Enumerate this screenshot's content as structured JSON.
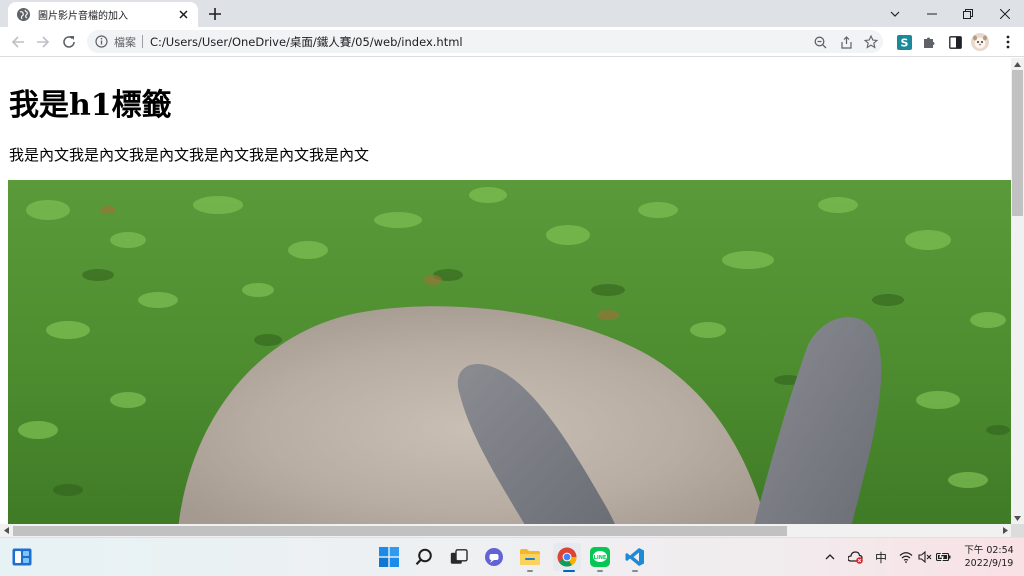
{
  "tab": {
    "title": "圖片影片音檔的加入"
  },
  "address_bar": {
    "security_label": "檔案",
    "url": "C:/Users/User/OneDrive/桌面/鐵人賽/05/web/index.html"
  },
  "page": {
    "heading": "我是h1標籤",
    "paragraph": "我是內文我是內文我是內文我是內文我是內文我是內文",
    "image_subject": "gray rabbit on grass"
  },
  "taskbar": {
    "ime": "中",
    "clock_time": "下午 02:54",
    "clock_date": "2022/9/19"
  },
  "colors": {
    "tabstrip": "#dee1e6",
    "omnibox": "#f1f3f4",
    "extension_s": "#1a8a9a",
    "vscode": "#1e8ad6",
    "line_app": "#06c755"
  }
}
